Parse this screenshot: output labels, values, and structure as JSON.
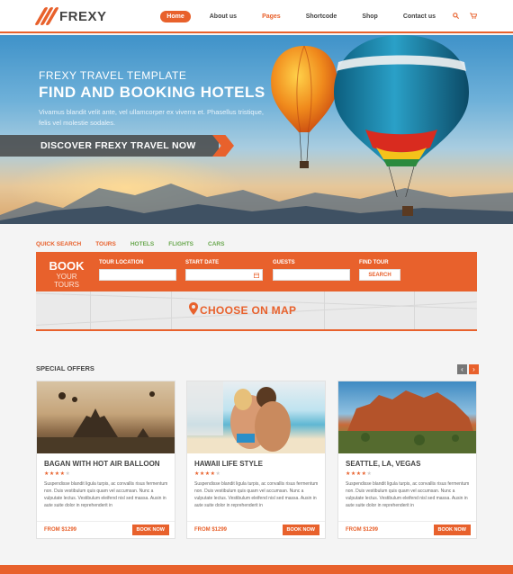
{
  "header": {
    "brand": "FREXY",
    "nav": [
      {
        "label": "Home",
        "active": true
      },
      {
        "label": "About us"
      },
      {
        "label": "Pages"
      },
      {
        "label": "Shortcode"
      },
      {
        "label": "Shop"
      },
      {
        "label": "Contact us"
      }
    ],
    "icons": [
      "search-icon",
      "cart-icon"
    ]
  },
  "hero": {
    "subtitle": "FREXY TRAVEL TEMPLATE",
    "title": "FIND AND BOOKING HOTELS",
    "text": "Vivamus blandit velit ante, vel ullamcorper ex viverra et. Phasellus tristique, felis vel molestie sodales.",
    "cta": "DISCOVER FREXY TRAVEL NOW"
  },
  "search": {
    "tabs": [
      "QUICK SEARCH",
      "TOURS",
      "HOTELS",
      "FLIGHTS",
      "CARS"
    ],
    "active_tab": "TOURS",
    "book_title": "BOOK",
    "book_sub": "YOUR TOURS",
    "labels": {
      "location": "TOUR LOCATION",
      "start": "START DATE",
      "guests": "GUESTS",
      "find": "FIND TOUR"
    },
    "search_button": "SEARCH",
    "map_label": "CHOOSE ON MAP"
  },
  "offers": {
    "title": "SPECIAL OFFERS",
    "cards": [
      {
        "title": "BAGAN WITH HOT AIR BALLOON",
        "rating": 4,
        "desc": "Suspendisse blandit ligula turpis, ac convallis risus fermentum non. Duis vestibulum quis quam vel accumsan. Nunc a vulputate lectus. Vestibulum eleifend nisl sed massa. Ausin in aute suite dolor in reprehenderit in",
        "price": "FROM $1299",
        "button": "BOOK NOW"
      },
      {
        "title": "HAWAII LIFE STYLE",
        "rating": 4,
        "desc": "Suspendisse blandit ligula turpis, ac convallis risus fermentum non. Duis vestibulum quis quam vel accumsan. Nunc a vulputate lectus. Vestibulum eleifend nisl sed massa. Ausin in aute suite dolor in reprehenderit in",
        "price": "FROM $1299",
        "button": "BOOK NOW"
      },
      {
        "title": "SEATTLE, LA, VEGAS",
        "rating": 4,
        "desc": "Suspendisse blandit ligula turpis, ac convallis risus fermentum non. Duis vestibulum quis quam vel accumsan. Nunc a vulputate lectus. Vestibulum eleifend nisl sed massa. Ausin in aute suite dolor in reprehenderit in",
        "price": "FROM $1299",
        "button": "BOOK NOW"
      }
    ]
  },
  "colors": {
    "accent": "#e8612c",
    "green": "#6aa84f",
    "dark": "#444444"
  }
}
